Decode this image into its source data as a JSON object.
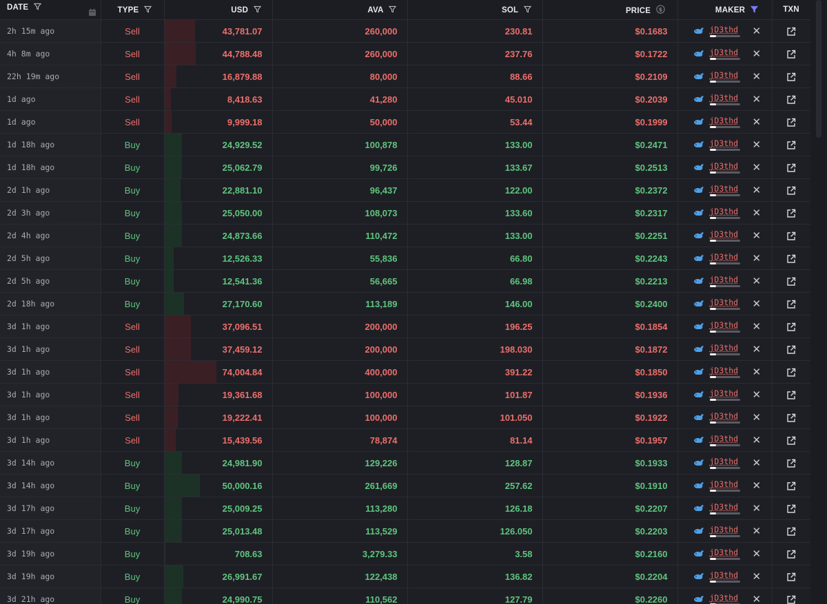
{
  "header": {
    "date": "DATE",
    "type": "TYPE",
    "usd": "USD",
    "token": "AVA",
    "sol": "SOL",
    "price": "PRICE",
    "maker": "MAKER",
    "txn": "TXN"
  },
  "colors": {
    "sell": "#ec6f6a",
    "buy": "#5fc57e",
    "filter_active": "#7a7cff"
  },
  "rows": [
    {
      "date": "2h 15m ago",
      "type": "Sell",
      "usd": "43,781.07",
      "usd_value": 43781.07,
      "ava": "260,000",
      "sol": "230.81",
      "price": "$0.1683",
      "maker": "jD3thd"
    },
    {
      "date": "4h 8m ago",
      "type": "Sell",
      "usd": "44,788.48",
      "usd_value": 44788.48,
      "ava": "260,000",
      "sol": "237.76",
      "price": "$0.1722",
      "maker": "jD3thd"
    },
    {
      "date": "22h 19m ago",
      "type": "Sell",
      "usd": "16,879.88",
      "usd_value": 16879.88,
      "ava": "80,000",
      "sol": "88.66",
      "price": "$0.2109",
      "maker": "jD3thd"
    },
    {
      "date": "1d ago",
      "type": "Sell",
      "usd": "8,418.63",
      "usd_value": 8418.63,
      "ava": "41,280",
      "sol": "45.010",
      "price": "$0.2039",
      "maker": "jD3thd"
    },
    {
      "date": "1d ago",
      "type": "Sell",
      "usd": "9,999.18",
      "usd_value": 9999.18,
      "ava": "50,000",
      "sol": "53.44",
      "price": "$0.1999",
      "maker": "jD3thd"
    },
    {
      "date": "1d 18h ago",
      "type": "Buy",
      "usd": "24,929.52",
      "usd_value": 24929.52,
      "ava": "100,878",
      "sol": "133.00",
      "price": "$0.2471",
      "maker": "jD3thd"
    },
    {
      "date": "1d 18h ago",
      "type": "Buy",
      "usd": "25,062.79",
      "usd_value": 25062.79,
      "ava": "99,726",
      "sol": "133.67",
      "price": "$0.2513",
      "maker": "jD3thd"
    },
    {
      "date": "2d 1h ago",
      "type": "Buy",
      "usd": "22,881.10",
      "usd_value": 22881.1,
      "ava": "96,437",
      "sol": "122.00",
      "price": "$0.2372",
      "maker": "jD3thd"
    },
    {
      "date": "2d 3h ago",
      "type": "Buy",
      "usd": "25,050.00",
      "usd_value": 25050.0,
      "ava": "108,073",
      "sol": "133.60",
      "price": "$0.2317",
      "maker": "jD3thd"
    },
    {
      "date": "2d 4h ago",
      "type": "Buy",
      "usd": "24,873.66",
      "usd_value": 24873.66,
      "ava": "110,472",
      "sol": "133.00",
      "price": "$0.2251",
      "maker": "jD3thd"
    },
    {
      "date": "2d 5h ago",
      "type": "Buy",
      "usd": "12,526.33",
      "usd_value": 12526.33,
      "ava": "55,836",
      "sol": "66.80",
      "price": "$0.2243",
      "maker": "jD3thd"
    },
    {
      "date": "2d 5h ago",
      "type": "Buy",
      "usd": "12,541.36",
      "usd_value": 12541.36,
      "ava": "56,665",
      "sol": "66.98",
      "price": "$0.2213",
      "maker": "jD3thd"
    },
    {
      "date": "2d 18h ago",
      "type": "Buy",
      "usd": "27,170.60",
      "usd_value": 27170.6,
      "ava": "113,189",
      "sol": "146.00",
      "price": "$0.2400",
      "maker": "jD3thd"
    },
    {
      "date": "3d 1h ago",
      "type": "Sell",
      "usd": "37,096.51",
      "usd_value": 37096.51,
      "ava": "200,000",
      "sol": "196.25",
      "price": "$0.1854",
      "maker": "jD3thd"
    },
    {
      "date": "3d 1h ago",
      "type": "Sell",
      "usd": "37,459.12",
      "usd_value": 37459.12,
      "ava": "200,000",
      "sol": "198.030",
      "price": "$0.1872",
      "maker": "jD3thd"
    },
    {
      "date": "3d 1h ago",
      "type": "Sell",
      "usd": "74,004.84",
      "usd_value": 74004.84,
      "ava": "400,000",
      "sol": "391.22",
      "price": "$0.1850",
      "maker": "jD3thd"
    },
    {
      "date": "3d 1h ago",
      "type": "Sell",
      "usd": "19,361.68",
      "usd_value": 19361.68,
      "ava": "100,000",
      "sol": "101.87",
      "price": "$0.1936",
      "maker": "jD3thd"
    },
    {
      "date": "3d 1h ago",
      "type": "Sell",
      "usd": "19,222.41",
      "usd_value": 19222.41,
      "ava": "100,000",
      "sol": "101.050",
      "price": "$0.1922",
      "maker": "jD3thd"
    },
    {
      "date": "3d 1h ago",
      "type": "Sell",
      "usd": "15,439.56",
      "usd_value": 15439.56,
      "ava": "78,874",
      "sol": "81.14",
      "price": "$0.1957",
      "maker": "jD3thd"
    },
    {
      "date": "3d 14h ago",
      "type": "Buy",
      "usd": "24,981.90",
      "usd_value": 24981.9,
      "ava": "129,226",
      "sol": "128.87",
      "price": "$0.1933",
      "maker": "jD3thd"
    },
    {
      "date": "3d 14h ago",
      "type": "Buy",
      "usd": "50,000.16",
      "usd_value": 50000.16,
      "ava": "261,669",
      "sol": "257.62",
      "price": "$0.1910",
      "maker": "jD3thd"
    },
    {
      "date": "3d 17h ago",
      "type": "Buy",
      "usd": "25,009.25",
      "usd_value": 25009.25,
      "ava": "113,280",
      "sol": "126.18",
      "price": "$0.2207",
      "maker": "jD3thd"
    },
    {
      "date": "3d 17h ago",
      "type": "Buy",
      "usd": "25,013.48",
      "usd_value": 25013.48,
      "ava": "113,529",
      "sol": "126.050",
      "price": "$0.2203",
      "maker": "jD3thd"
    },
    {
      "date": "3d 19h ago",
      "type": "Buy",
      "usd": "708.63",
      "usd_value": 708.63,
      "ava": "3,279.33",
      "sol": "3.58",
      "price": "$0.2160",
      "maker": "jD3thd"
    },
    {
      "date": "3d 19h ago",
      "type": "Buy",
      "usd": "26,991.67",
      "usd_value": 26991.67,
      "ava": "122,438",
      "sol": "136.82",
      "price": "$0.2204",
      "maker": "jD3thd"
    },
    {
      "date": "3d 21h ago",
      "type": "Buy",
      "usd": "24,990.75",
      "usd_value": 24990.75,
      "ava": "110,562",
      "sol": "127.79",
      "price": "$0.2260",
      "maker": "jD3thd"
    }
  ]
}
